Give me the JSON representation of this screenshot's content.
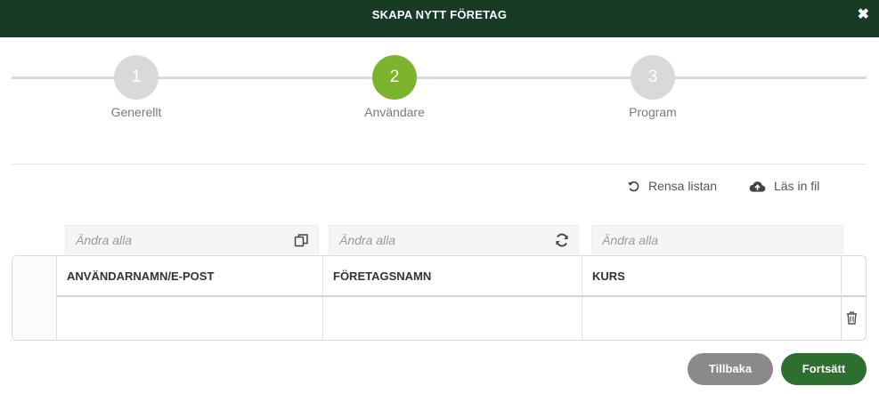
{
  "header": {
    "title": "SKAPA NYTT FÖRETAG",
    "close_glyph": "✖"
  },
  "steps": [
    {
      "number": "1",
      "label": "Generellt",
      "active": false
    },
    {
      "number": "2",
      "label": "Användare",
      "active": true
    },
    {
      "number": "3",
      "label": "Program",
      "active": false
    }
  ],
  "actions": {
    "clear_list": "Rensa listan",
    "load_file": "Läs in fil"
  },
  "edit_all": {
    "username_placeholder": "Ändra alla",
    "company_placeholder": "Ändra alla",
    "course_placeholder": "Ändra alla"
  },
  "table": {
    "columns": [
      "ANVÄNDARNAMN/E-POST",
      "FÖRETAGSNAMN",
      "KURS"
    ],
    "rows": [
      {
        "username": "",
        "company": "",
        "course": ""
      }
    ]
  },
  "buttons": {
    "back": "Tillbaka",
    "continue": "Fortsätt"
  },
  "colors": {
    "header_bg": "#173b24",
    "active_step": "#7cb32f",
    "inactive_step": "#d9d9d9",
    "continue_btn": "#2e6e2e",
    "back_btn": "#8a8a8a"
  },
  "icons": {
    "close": "close-icon",
    "clear": "refresh-ccw-icon",
    "upload": "cloud-upload-icon",
    "copy": "copy-icon",
    "sync": "sync-icon",
    "delete": "trash-icon"
  }
}
